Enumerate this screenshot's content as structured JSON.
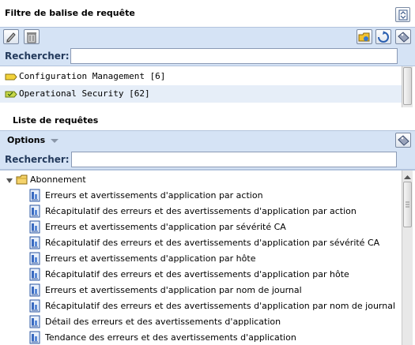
{
  "tag_filter": {
    "title": "Filtre de balise de requête",
    "search_label": "Rechercher:",
    "search_value": "",
    "tags": [
      {
        "label": "Configuration Management [6]",
        "selected": false
      },
      {
        "label": "Operational Security [62]",
        "selected": true
      }
    ]
  },
  "query_list": {
    "title": "Liste de requêtes",
    "options_label": "Options",
    "search_label": "Rechercher:",
    "search_value": "",
    "folder": "Abonnement",
    "queries": [
      "Erreurs et avertissements d'application par action",
      "Récapitulatif des erreurs et des avertissements d'application par action",
      "Erreurs et avertissements d'application par sévérité CA",
      "Récapitulatif des erreurs et des avertissements d'application par sévérité CA",
      "Erreurs et avertissements d'application par hôte",
      "Récapitulatif des erreurs et des avertissements d'application par hôte",
      "Erreurs et avertissements d'application par nom de journal",
      "Récapitulatif des erreurs et des avertissements d'application par nom de journal",
      "Détail des erreurs et des avertissements d'application",
      "Tendance des erreurs et des avertissements d'application"
    ]
  },
  "colors": {
    "toolbar_bg": "#d5e3f5",
    "selected_row": "#e6eef8",
    "tag_yellow": "#f2d23a",
    "tag_green_yellow": "#c8d84a",
    "folder_yellow": "#f5d36b"
  }
}
